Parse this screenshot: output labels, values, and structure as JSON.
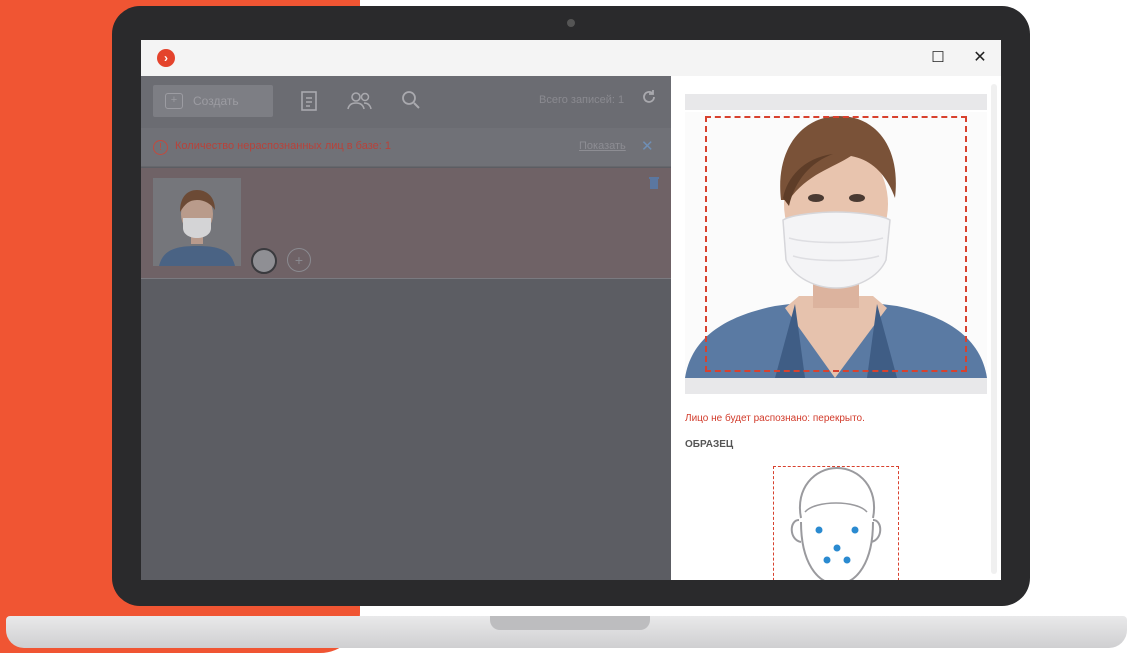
{
  "window": {
    "logo": "›",
    "maximize": "☐",
    "close": "✕"
  },
  "toolbar": {
    "create_label": "Создать",
    "records_label": "Всего записей: 1"
  },
  "alert": {
    "text": "Количество нераспознанных лиц в базе: 1",
    "link": "Показать",
    "close": "✕"
  },
  "right_panel": {
    "warning": "Лицо не будет распознано: перекрыто.",
    "sample_label": "ОБРАЗЕЦ"
  },
  "colors": {
    "brand": "#f05533",
    "alert_red": "#d23b2b",
    "frame_dash": "#d8412e"
  }
}
